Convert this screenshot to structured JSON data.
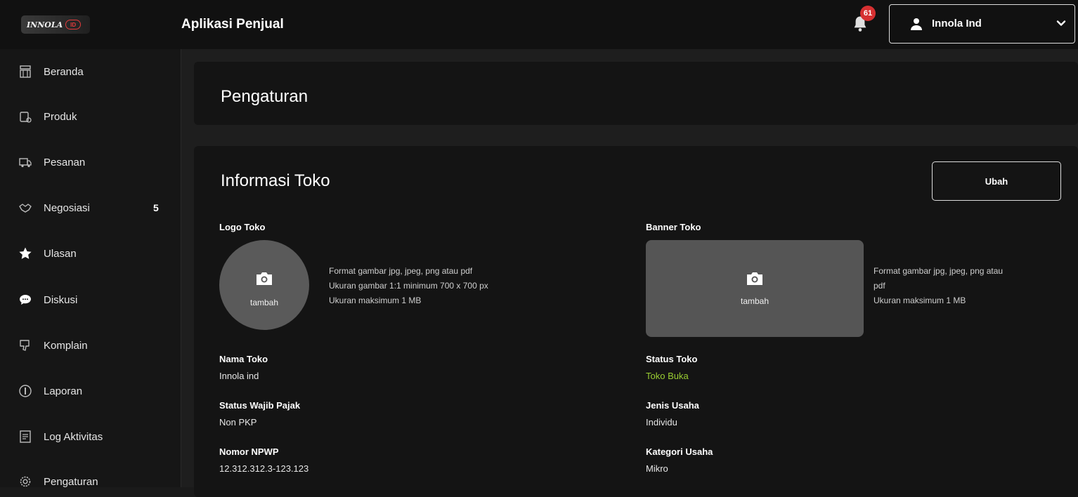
{
  "header": {
    "logo_text": "INNOLA",
    "logo_badge": "ID",
    "app_title": "Aplikasi Penjual",
    "notification_count": "61",
    "user_name": "Innola Ind"
  },
  "sidebar": {
    "items": [
      {
        "label": "Beranda",
        "icon": "store-icon"
      },
      {
        "label": "Produk",
        "icon": "product-icon"
      },
      {
        "label": "Pesanan",
        "icon": "truck-icon"
      },
      {
        "label": "Negosiasi",
        "icon": "handshake-icon",
        "badge": "5"
      },
      {
        "label": "Ulasan",
        "icon": "star-icon"
      },
      {
        "label": "Diskusi",
        "icon": "chat-icon"
      },
      {
        "label": "Komplain",
        "icon": "thumbs-down-icon"
      },
      {
        "label": "Laporan",
        "icon": "report-icon"
      },
      {
        "label": "Log Aktivitas",
        "icon": "log-icon"
      },
      {
        "label": "Pengaturan",
        "icon": "gear-icon"
      }
    ]
  },
  "main": {
    "page_title": "Pengaturan",
    "info": {
      "title": "Informasi Toko",
      "edit_label": "Ubah",
      "logo": {
        "label": "Logo Toko",
        "upload_label": "tambah",
        "help": [
          "Format gambar jpg, jpeg, png atau pdf",
          "Ukuran gambar 1:1 minimum 700 x 700 px",
          "Ukuran maksimum 1 MB"
        ]
      },
      "banner": {
        "label": "Banner Toko",
        "upload_label": "tambah",
        "help": [
          "Format gambar jpg, jpeg, png atau",
          "pdf",
          "Ukuran maksimum 1 MB"
        ]
      },
      "fields_left": [
        {
          "label": "Nama Toko",
          "value": "Innola ind"
        },
        {
          "label": "Status Wajib Pajak",
          "value": "Non PKP"
        },
        {
          "label": "Nomor NPWP",
          "value": "12.312.312.3-123.123"
        }
      ],
      "fields_right": [
        {
          "label": "Status Toko",
          "value": "Toko Buka",
          "color": "#9acd32"
        },
        {
          "label": "Jenis Usaha",
          "value": "Individu"
        },
        {
          "label": "Kategori Usaha",
          "value": "Mikro"
        }
      ]
    }
  }
}
